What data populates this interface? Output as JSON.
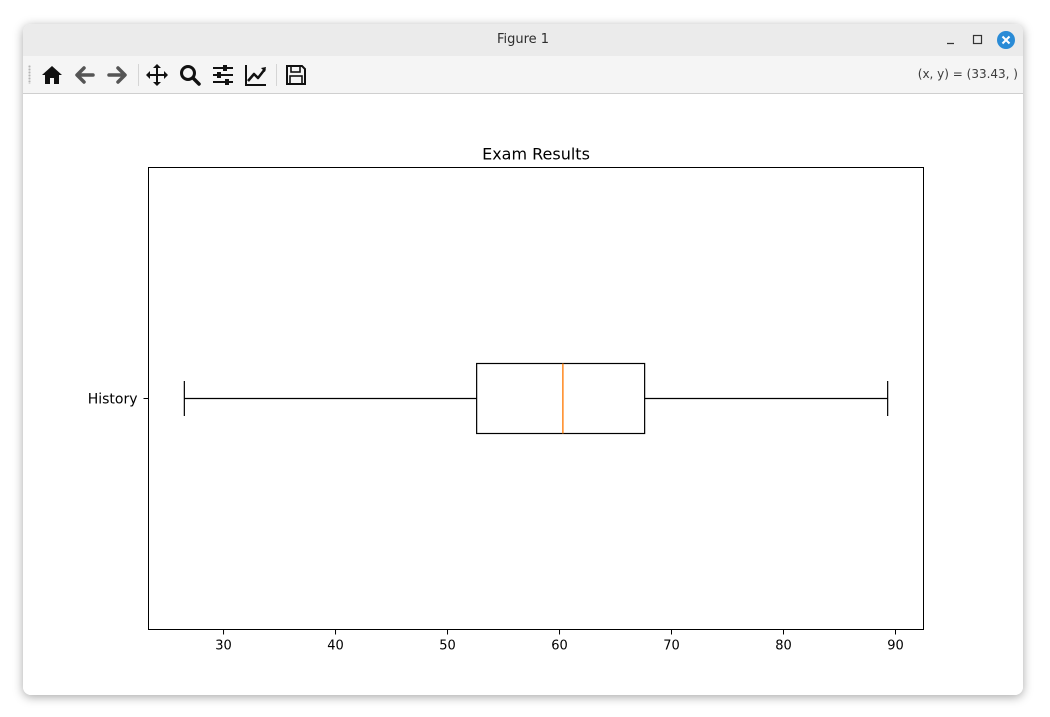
{
  "window": {
    "title": "Figure 1"
  },
  "toolbar": {
    "tools": [
      "home-icon",
      "back-arrow-icon",
      "forward-arrow-icon",
      "pan-icon",
      "zoom-icon",
      "configure-subplots-icon",
      "edit-axis-icon",
      "save-icon"
    ],
    "coords_text": "(x, y) = (33.43, )"
  },
  "chart_data": {
    "type": "boxplot",
    "orientation": "horizontal",
    "title": "Exam Results",
    "xlabel": "",
    "ylabel": "",
    "categories": [
      "History"
    ],
    "boxes": [
      {
        "label": "History",
        "whisker_low": 26.5,
        "q1": 52.6,
        "median": 60.3,
        "q3": 67.6,
        "whisker_high": 89.3
      }
    ],
    "xlim": [
      23.3,
      92.5
    ],
    "xticks": [
      30,
      40,
      50,
      60,
      70,
      80,
      90
    ],
    "grid": false,
    "colors": {
      "box": "#000000",
      "median": "#ff7f0e"
    }
  }
}
